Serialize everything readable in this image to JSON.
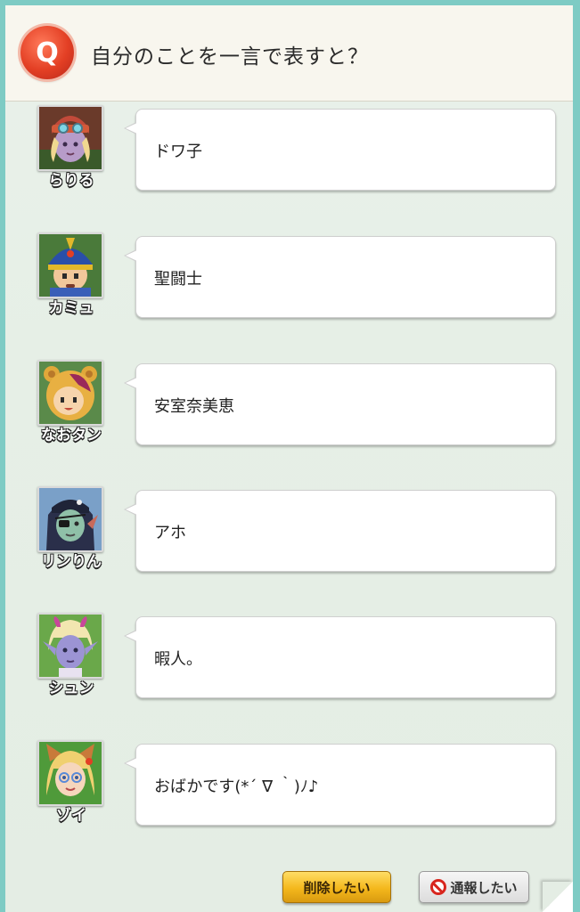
{
  "question": {
    "badge": "Q",
    "text": "自分のことを一言で表すと？"
  },
  "answers": [
    {
      "name": "らりる",
      "answer": "ドワ子",
      "avatar_icon": "dwarf-girl-goggles-avatar"
    },
    {
      "name": "カミュ",
      "answer": "聖闘士",
      "avatar_icon": "blue-helmet-boy-avatar"
    },
    {
      "name": "なおタン",
      "answer": "安室奈美恵",
      "avatar_icon": "bear-hood-avatar"
    },
    {
      "name": "リンりん",
      "answer": "アホ",
      "avatar_icon": "eyepatch-girl-avatar"
    },
    {
      "name": "シュン",
      "answer": "暇人。",
      "avatar_icon": "horned-elf-avatar"
    },
    {
      "name": "ゾイ",
      "answer": "おばかです(*´ ∇ ｀)ﾉ♪",
      "avatar_icon": "cat-ear-girl-avatar"
    }
  ],
  "actions": {
    "delete_label": "削除したい",
    "report_label": "通報したい"
  },
  "colors": {
    "background": "#7ecbc4",
    "q_badge": "#e33f24",
    "delete_button": "#f4b81c"
  }
}
